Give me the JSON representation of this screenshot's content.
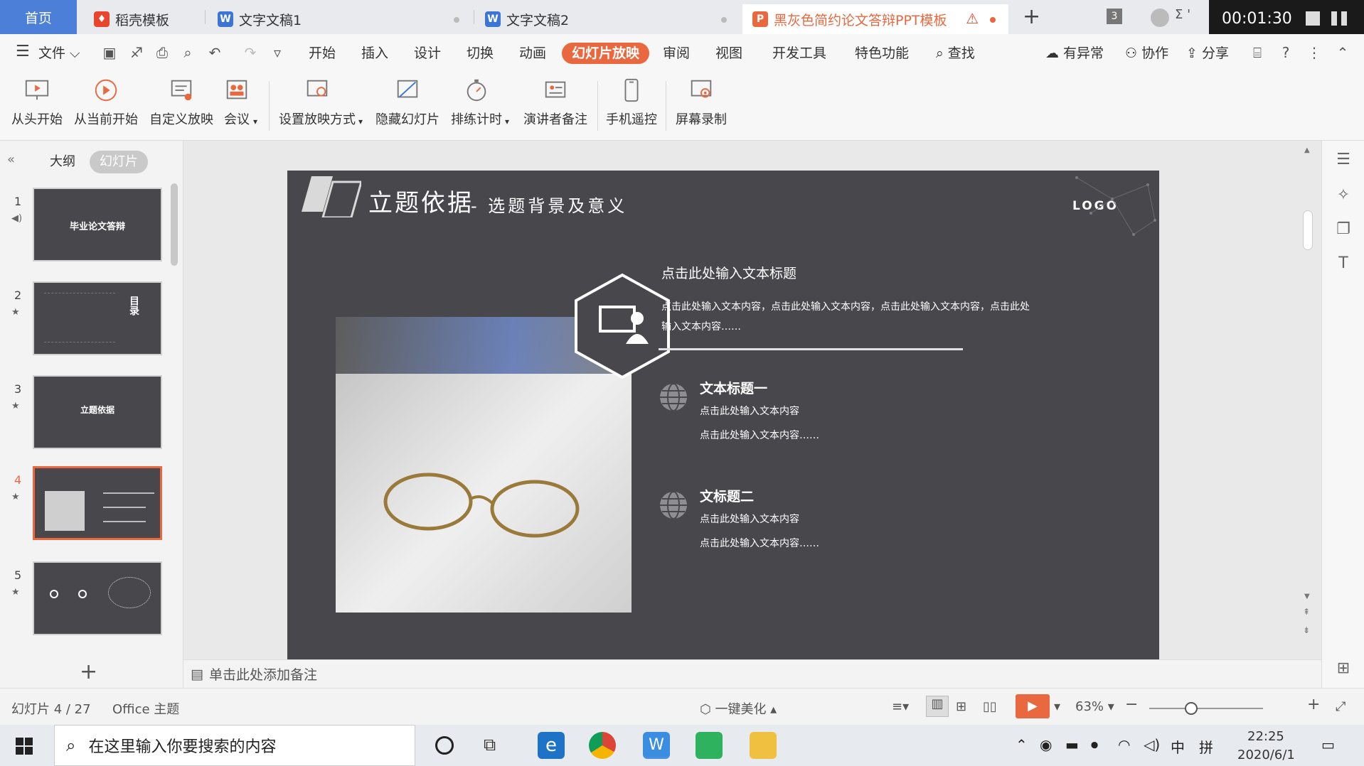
{
  "tabs": {
    "home": "首页",
    "items": [
      {
        "label": "稻壳模板",
        "color": "#e8452c"
      },
      {
        "label": "文字文稿1",
        "color": "#3b76d6"
      },
      {
        "label": "文字文稿2",
        "color": "#3b76d6"
      },
      {
        "label": "黑灰色简约论文答辩PPT模板",
        "color": "#e9683f"
      }
    ],
    "new_tab": "+",
    "window_count": "3"
  },
  "timer": "00:01:30",
  "menu": {
    "file": "文件",
    "items": [
      "开始",
      "插入",
      "设计",
      "切换",
      "动画",
      "幻灯片放映",
      "审阅",
      "视图",
      "开发工具",
      "特色功能"
    ],
    "active": "幻灯片放映",
    "search": "查找",
    "right": [
      "有异常",
      "协作",
      "分享"
    ]
  },
  "ribbon": [
    "从头开始",
    "从当前开始",
    "自定义放映",
    "会议",
    "设置放映方式",
    "隐藏幻灯片",
    "排练计时",
    "演讲者备注",
    "手机遥控",
    "屏幕录制"
  ],
  "left_panel": {
    "tab_outline": "大纲",
    "tab_slides": "幻灯片",
    "thumbs": [
      {
        "num": "1",
        "title": "毕业论文答辩"
      },
      {
        "num": "2",
        "title": "目录"
      },
      {
        "num": "3",
        "title": "立题依据"
      },
      {
        "num": "4",
        "title": ""
      },
      {
        "num": "5",
        "title": ""
      }
    ],
    "add": "+"
  },
  "slide": {
    "title": "立题依据",
    "subtitle": "- 选题背景及意义",
    "logo": "LOGO",
    "text_heading": "点击此处输入文本标题",
    "text_body": "点击此处输入文本内容，点击此处输入文本内容，点击此处输入文本内容，点击此处输入文本内容……",
    "item1_title": "文本标题一",
    "item1_line1": "点击此处输入文本内容",
    "item1_line2": "点击此处输入文本内容……",
    "item2_title": "文标题二",
    "item2_line1": "点击此处输入文本内容",
    "item2_line2": "点击此处输入文本内容……"
  },
  "notes_placeholder": "单击此处添加备注",
  "status": {
    "slide_counter": "幻灯片 4 / 27",
    "theme": "Office 主题",
    "beautify": "一键美化",
    "zoom": "63%"
  },
  "taskbar": {
    "search_placeholder": "在这里输入你要搜索的内容",
    "time": "22:25",
    "date": "2020/6/1",
    "ime1": "中",
    "ime2": "拼"
  }
}
